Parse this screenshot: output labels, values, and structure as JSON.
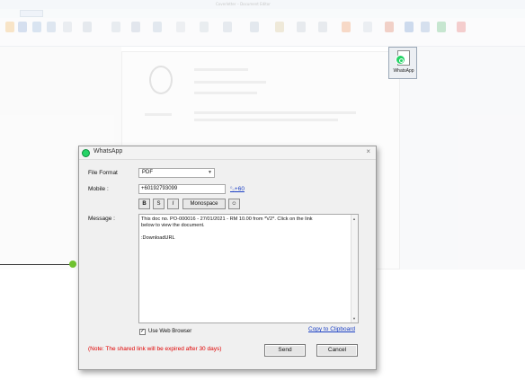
{
  "background_app": {
    "title": "Coverletter – Document Editor"
  },
  "whatsapp_ribbon_button": {
    "label": "WhatsApp"
  },
  "dialog": {
    "title": "WhatsApp",
    "close_glyph": "×",
    "file_format_label": "File Format",
    "file_format_value": "PDF",
    "mobile_label": "Mobile :",
    "mobile_value": "+60192793099",
    "country_code_link": "+60",
    "format_buttons": [
      "B",
      "S",
      "I",
      "Monospace"
    ],
    "message_label": "Message :",
    "message_lines": [
      "This doc no. PO-000016 - 27/01/2021 - RM 10.00 from *V2*. Click on the link",
      "below to view the document.",
      "",
      ":DownloadURL"
    ],
    "use_web_browser_label": "Use Web Browser",
    "use_web_browser_checked": true,
    "copy_clipboard_link": "Copy to Clipboard",
    "note": "(Note: The shared link will be expired after 30 days)",
    "send_button": "Send",
    "cancel_button": "Cancel"
  },
  "colors": {
    "link": "#1a3fc4",
    "note": "#e00000",
    "whatsapp_green": "#25d366",
    "connector_dot": "#6fc22f"
  }
}
